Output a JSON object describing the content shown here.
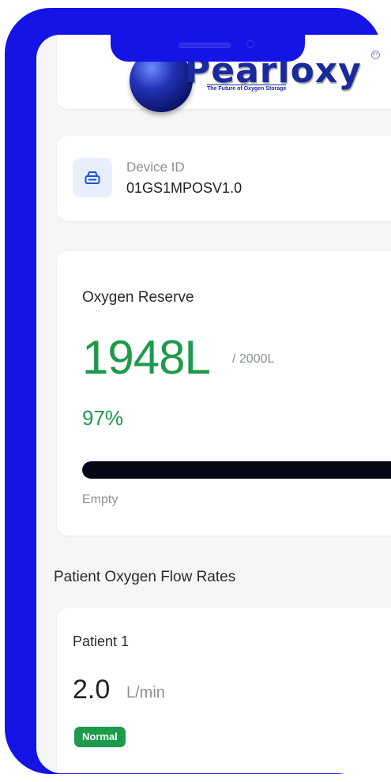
{
  "logo": {
    "brand": "Pearloxy",
    "tagline": "The Future of Oxygen Storage",
    "tm": "tm"
  },
  "device": {
    "label": "Device ID",
    "value": "01GS1MPOSV1.0",
    "icon": "hard-drive-icon"
  },
  "reserve": {
    "title": "Oxygen Reserve",
    "amount": "1948L",
    "capacity": "/ 2000L",
    "percent": "97%",
    "fill_fraction": 0.97,
    "empty_label": "Empty"
  },
  "patients": {
    "section_title": "Patient Oxygen Flow Rates",
    "items": [
      {
        "name": "Patient 1",
        "flow": "2.0",
        "unit": "L/min",
        "status": "Normal"
      }
    ]
  },
  "colors": {
    "frame": "#1414e6",
    "accent_green": "#1d9a4c",
    "bar_fill": "#050814"
  }
}
